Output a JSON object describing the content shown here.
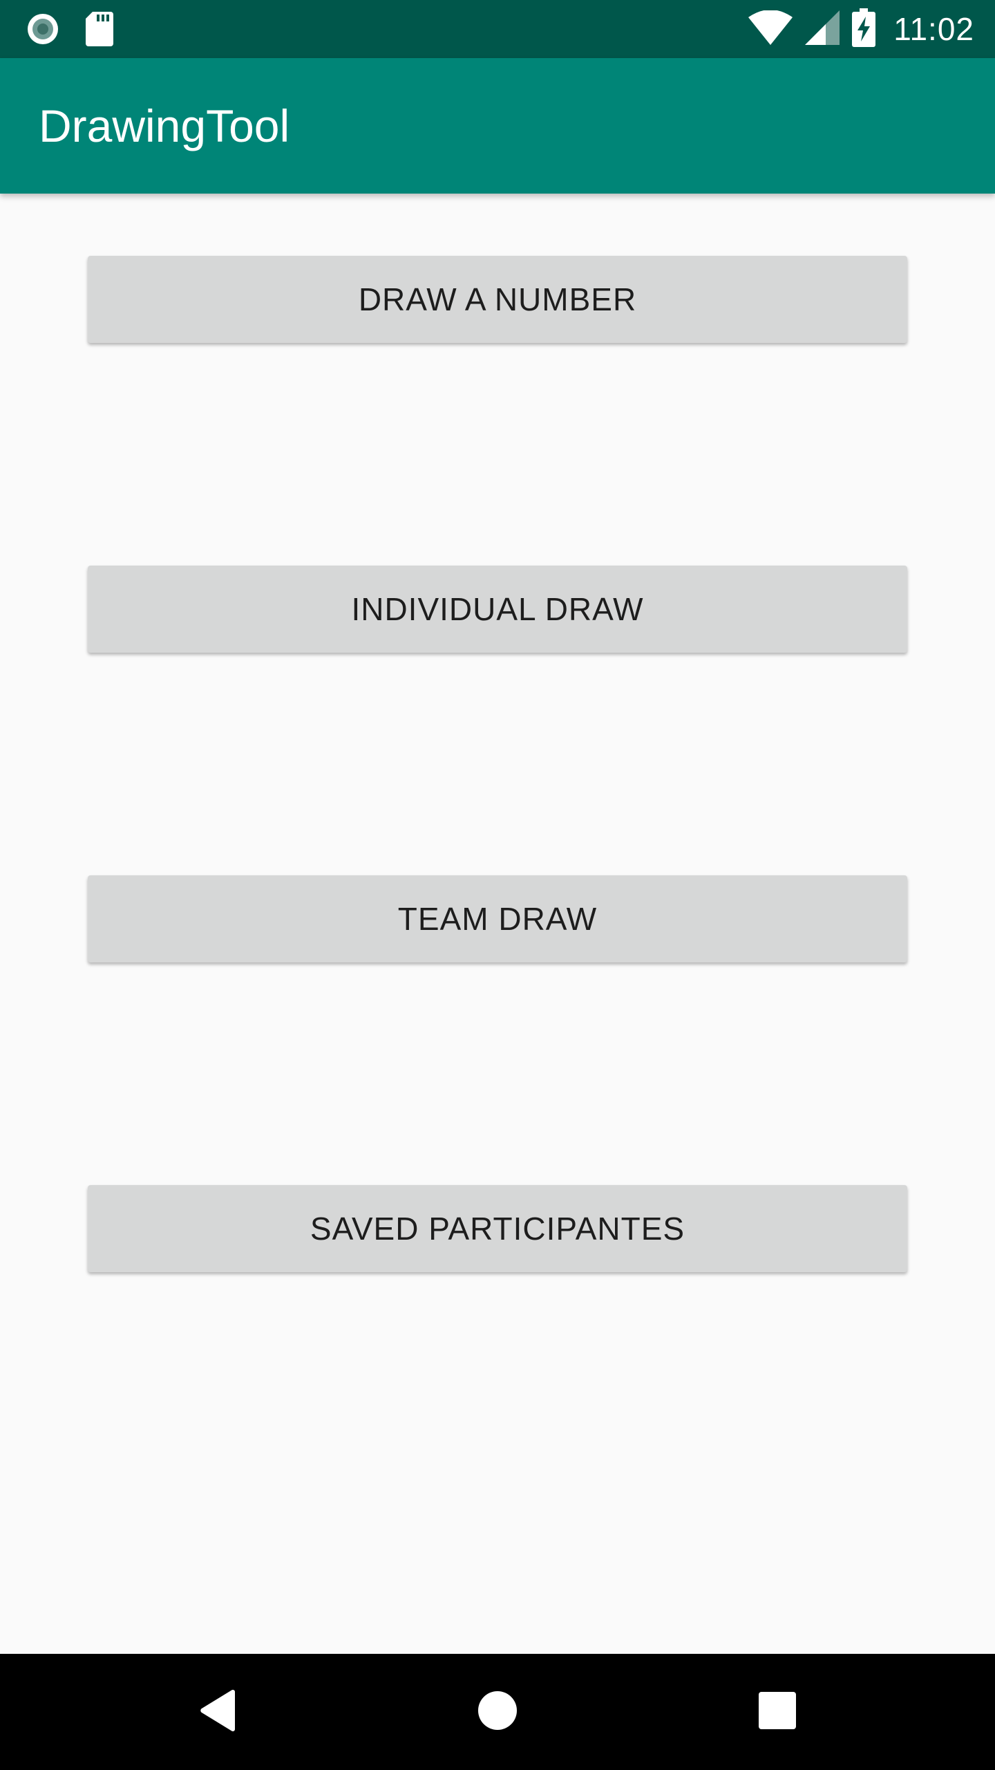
{
  "status_bar": {
    "time": "11:02",
    "icons": [
      "notification-circle-icon",
      "sd-card-icon",
      "wifi-icon",
      "cellular-signal-icon",
      "battery-charging-icon"
    ]
  },
  "app_bar": {
    "title": "DrawingTool",
    "color": "#008577"
  },
  "main": {
    "buttons": [
      {
        "label": "DRAW A NUMBER"
      },
      {
        "label": "INDIVIDUAL DRAW"
      },
      {
        "label": "TEAM DRAW"
      },
      {
        "label": "SAVED PARTICIPANTES"
      }
    ]
  },
  "nav_bar": {
    "icons": [
      "back-icon",
      "home-icon",
      "recents-icon"
    ]
  },
  "colors": {
    "status_bar": "#00574b",
    "app_bar": "#008577",
    "background": "#fafafa",
    "button": "#d6d7d7"
  }
}
